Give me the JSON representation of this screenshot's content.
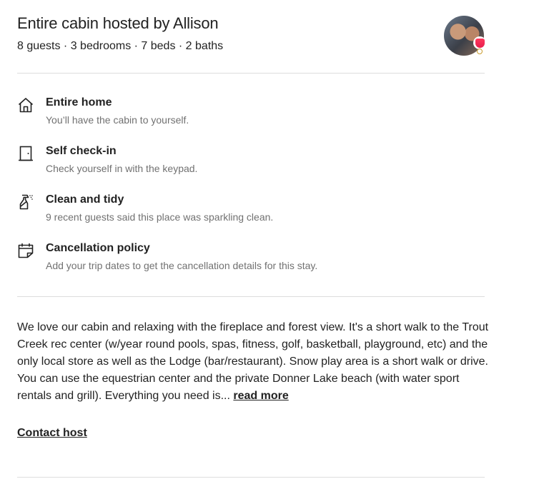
{
  "header": {
    "title": "Entire cabin hosted by Allison",
    "subtitle": "8 guests · 3 bedrooms · 7 beds · 2 baths"
  },
  "host": {
    "avatar_icon": "host-avatar-photo",
    "superhost_badge_icon": "superhost-shield-icon"
  },
  "features": [
    {
      "icon": "home-icon",
      "title": "Entire home",
      "description": "You’ll have the cabin to yourself."
    },
    {
      "icon": "door-icon",
      "title": "Self check-in",
      "description": "Check yourself in with the keypad."
    },
    {
      "icon": "spray-bottle-icon",
      "title": "Clean and tidy",
      "description": "9 recent guests said this place was sparkling clean."
    },
    {
      "icon": "calendar-icon",
      "title": "Cancellation policy",
      "description": "Add your trip dates to get the cancellation details for this stay."
    }
  ],
  "description": {
    "text": "We love our cabin and relaxing with the fireplace and forest view. It's a short walk to the Trout Creek rec center (w/year round pools, spas, fitness, golf, basketball, playground, etc) and the only local store as well as the Lodge (bar/restaurant). Snow play area is a short walk or drive. You can use the equestrian center and the private Donner Lake beach (with water sport rentals and grill). Everything you need is...",
    "read_more": "read more"
  },
  "contact_host": "Contact host",
  "colors": {
    "text": "#222222",
    "secondary_text": "#717171",
    "divider": "#dddddd",
    "badge": "#ff385c"
  }
}
